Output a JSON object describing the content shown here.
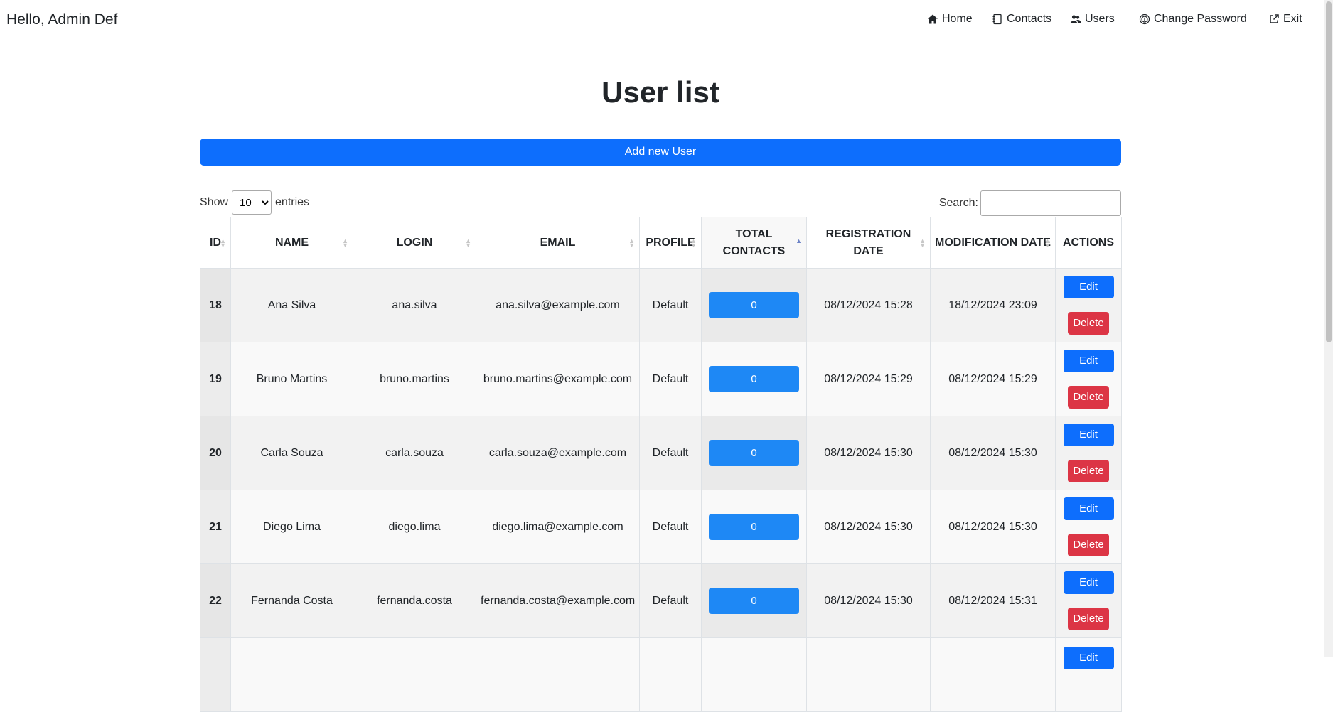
{
  "navbar": {
    "greeting": "Hello, Admin Def",
    "items": [
      {
        "label": "Home",
        "icon": "home-icon"
      },
      {
        "label": "Contacts",
        "icon": "address-book-icon"
      },
      {
        "label": "Users",
        "icon": "users-icon"
      },
      {
        "label": "Change Password",
        "icon": "fingerprint-icon"
      },
      {
        "label": "Exit",
        "icon": "external-link-icon"
      }
    ]
  },
  "page": {
    "title": "User list",
    "add_button": "Add new User"
  },
  "table_controls": {
    "show_label": "Show",
    "entries_value": "10",
    "entries_label": "entries",
    "search_label": "Search:",
    "search_value": ""
  },
  "table": {
    "columns": [
      "ID",
      "NAME",
      "LOGIN",
      "EMAIL",
      "PROFILE",
      "TOTAL CONTACTS",
      "REGISTRATION DATE",
      "MODIFICATION DATE",
      "ACTIONS"
    ],
    "sorted_column": "TOTAL CONTACTS",
    "edit_label": "Edit",
    "delete_label": "Delete",
    "rows": [
      {
        "id": "18",
        "name": "Ana Silva",
        "login": "ana.silva",
        "email": "ana.silva@example.com",
        "profile": "Default",
        "contacts": "0",
        "registered": "08/12/2024 15:28",
        "modified": "18/12/2024 23:09"
      },
      {
        "id": "19",
        "name": "Bruno Martins",
        "login": "bruno.martins",
        "email": "bruno.martins@example.com",
        "profile": "Default",
        "contacts": "0",
        "registered": "08/12/2024 15:29",
        "modified": "08/12/2024 15:29"
      },
      {
        "id": "20",
        "name": "Carla Souza",
        "login": "carla.souza",
        "email": "carla.souza@example.com",
        "profile": "Default",
        "contacts": "0",
        "registered": "08/12/2024 15:30",
        "modified": "08/12/2024 15:30"
      },
      {
        "id": "21",
        "name": "Diego Lima",
        "login": "diego.lima",
        "email": "diego.lima@example.com",
        "profile": "Default",
        "contacts": "0",
        "registered": "08/12/2024 15:30",
        "modified": "08/12/2024 15:30"
      },
      {
        "id": "22",
        "name": "Fernanda Costa",
        "login": "fernanda.costa",
        "email": "fernanda.costa@example.com",
        "profile": "Default",
        "contacts": "0",
        "registered": "08/12/2024 15:30",
        "modified": "08/12/2024 15:31"
      },
      {
        "id": "",
        "name": "",
        "login": "",
        "email": "",
        "profile": "",
        "contacts": "",
        "registered": "",
        "modified": ""
      }
    ]
  },
  "colors": {
    "primary": "#0d6efd",
    "danger": "#dc3545",
    "count_button": "#1e88f5"
  }
}
